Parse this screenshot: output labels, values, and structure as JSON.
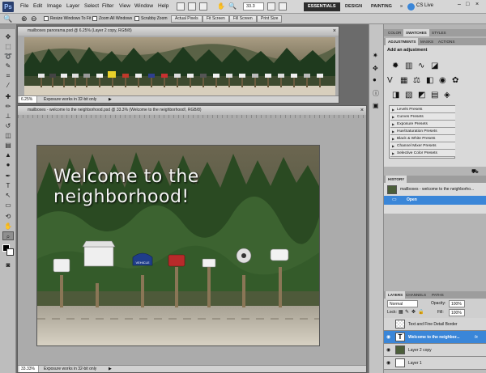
{
  "menubar": {
    "logo": "Ps",
    "items": [
      "File",
      "Edit",
      "Image",
      "Layer",
      "Select",
      "Filter",
      "View",
      "Window",
      "Help"
    ],
    "zoom": "33.3",
    "workspaces": [
      "ESSENTIALS",
      "DESIGN",
      "PAINTING"
    ],
    "more": "»",
    "cslive": "CS Live"
  },
  "options": {
    "resize_windows": "Resize Windows To Fit",
    "zoom_all": "Zoom All Windows",
    "scrubby_zoom": "Scrubby Zoom",
    "actual_pixels": "Actual Pixels",
    "fit_screen": "Fit Screen",
    "fill_screen": "Fill Screen",
    "print_size": "Print Size"
  },
  "doc1": {
    "title": "mailboxes panorama.psd @ 6.25% (Layer 2 copy, RGB/8)",
    "zoom": "6.25%",
    "status": "Exposure works in 32-bit only"
  },
  "doc2": {
    "title": "mailboxes - welcome to the neighborhood.psd @ 33.3% (Welcome to the neighborhood!, RGB/8)",
    "zoom": "33.33%",
    "status": "Exposure works in 32-bit only",
    "headline": "Welcome to the neighborhood!",
    "mailbox_label": "VEHICLE"
  },
  "panels": {
    "top_tabs": [
      "COLOR",
      "SWATCHES",
      "STYLES"
    ],
    "adj_tabs": [
      "ADJUSTMENTS",
      "MASKS",
      "ACTIONS"
    ],
    "adj_title": "Add an adjustment",
    "presets": [
      "Levels Presets",
      "Curves Presets",
      "Exposure Presets",
      "Hue/Saturation Presets",
      "Black & White Presets",
      "Channel Mixer Presets",
      "Selective Color Presets"
    ],
    "history_tab": "HISTORY",
    "history_snapshot": "mailboxes - welcome to the neighborho...",
    "history_open": "Open",
    "layers_tabs": [
      "LAYERS",
      "CHANNELS",
      "PATHS"
    ],
    "blend_mode": "Normal",
    "opacity_label": "Opacity:",
    "opacity": "100%",
    "lock_label": "Lock:",
    "fill_label": "Fill:",
    "fill": "100%",
    "layers": [
      "Text and Fine Detail Border",
      "Welcome to the neighbor...",
      "Layer 2 copy",
      "Layer 1"
    ],
    "text_layer_glyph": "T",
    "fx": "fx"
  },
  "colors": {
    "accent_blue": "#3a86d8",
    "active_workspace": "#2d2d2d"
  }
}
